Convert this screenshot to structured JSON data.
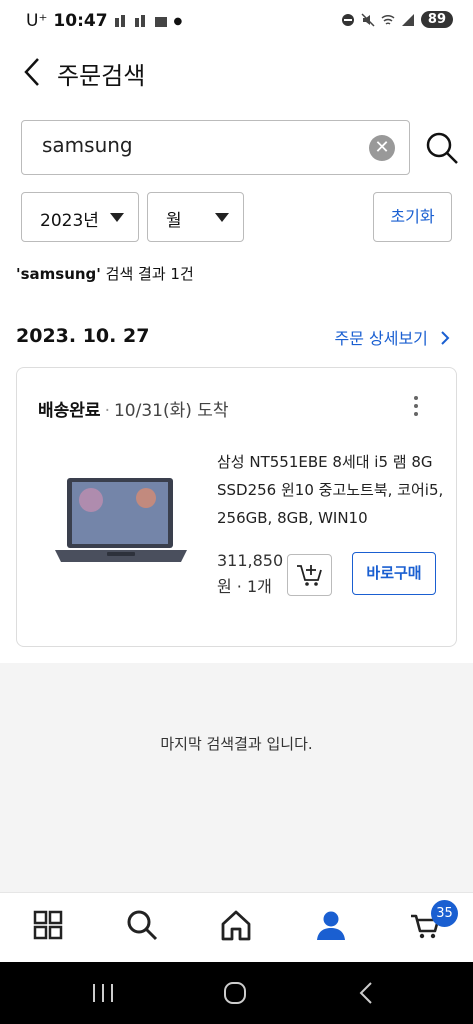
{
  "status_bar": {
    "carrier": "U⁺",
    "time": "10:47",
    "battery": "89"
  },
  "header": {
    "title": "주문검색"
  },
  "search": {
    "value": "samsung"
  },
  "filters": {
    "year": "2023년",
    "month": "월",
    "reset_label": "초기화"
  },
  "result": {
    "keyword": "'samsung'",
    "summary": " 검색 결과 1건"
  },
  "order": {
    "date": "2023. 10. 27",
    "detail_link": "주문 상세보기",
    "delivery_status": "배송완료",
    "delivery_date": "10/31(화) 도착",
    "product_name": "삼성 NT551EBE 8세대 i5 램 8G SSD256 윈10 중고노트북, 코어i5, 256GB, 8GB, WIN10",
    "price": "311,850",
    "price_unit_qty": "원 · 1개",
    "buy_now_label": "바로구매"
  },
  "end_message": "마지막 검색결과 입니다.",
  "bottom_nav": {
    "items": [
      "category-icon",
      "search-icon",
      "home-icon",
      "my-page-icon",
      "cart-icon"
    ],
    "cart_count": "35",
    "active_color": "#1a5fd1"
  }
}
